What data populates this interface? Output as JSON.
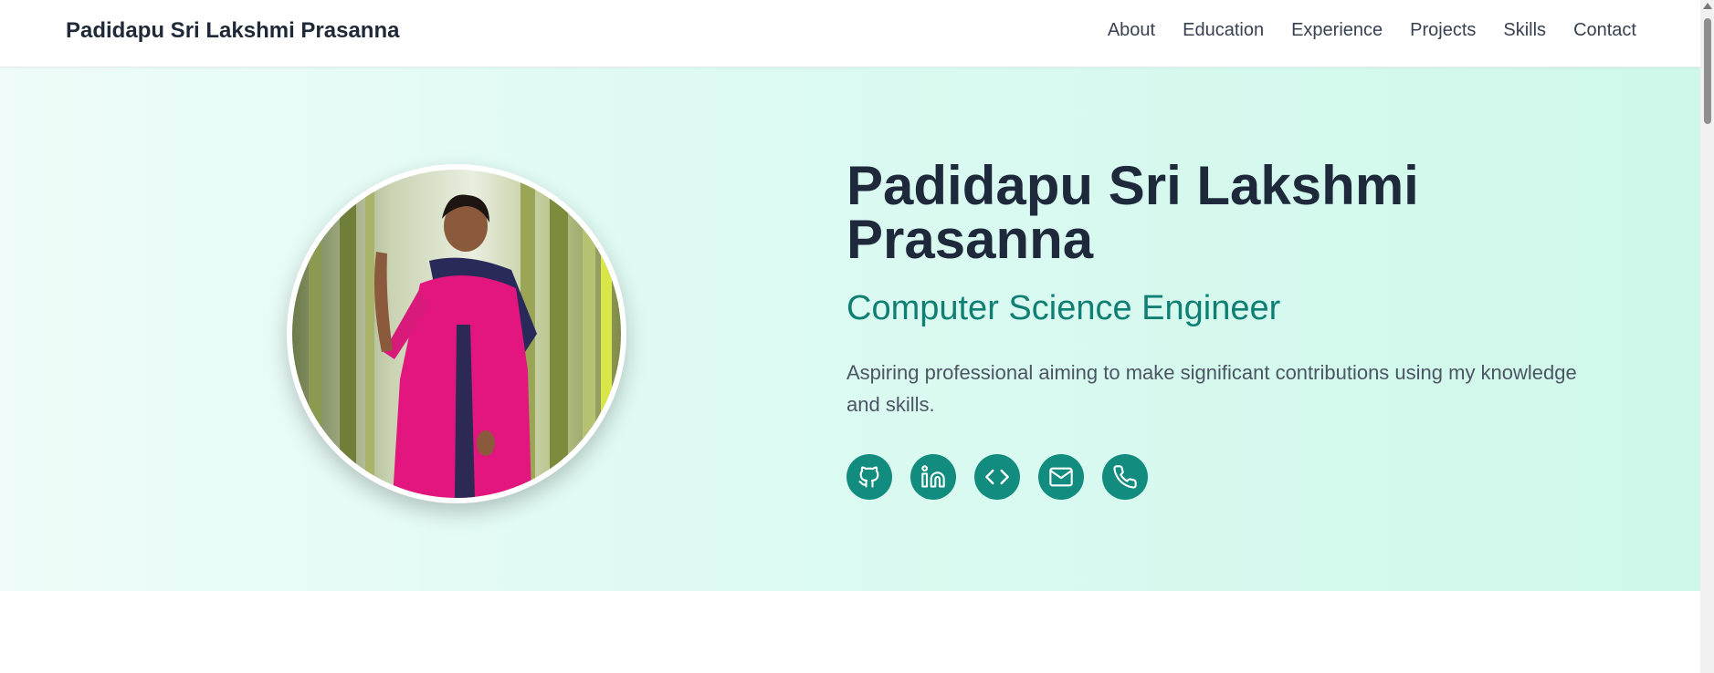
{
  "nav": {
    "brand": "Padidapu Sri Lakshmi Prasanna",
    "links": [
      "About",
      "Education",
      "Experience",
      "Projects",
      "Skills",
      "Contact"
    ]
  },
  "hero": {
    "name": "Padidapu Sri Lakshmi Prasanna",
    "title": "Computer Science Engineer",
    "description": "Aspiring professional aiming to make significant contributions using my knowledge and skills.",
    "socials": [
      "github-icon",
      "linkedin-icon",
      "code-icon",
      "mail-icon",
      "phone-icon"
    ]
  },
  "colors": {
    "accent": "#128c7e",
    "title": "#0f7f74",
    "heading": "#1e293b"
  }
}
